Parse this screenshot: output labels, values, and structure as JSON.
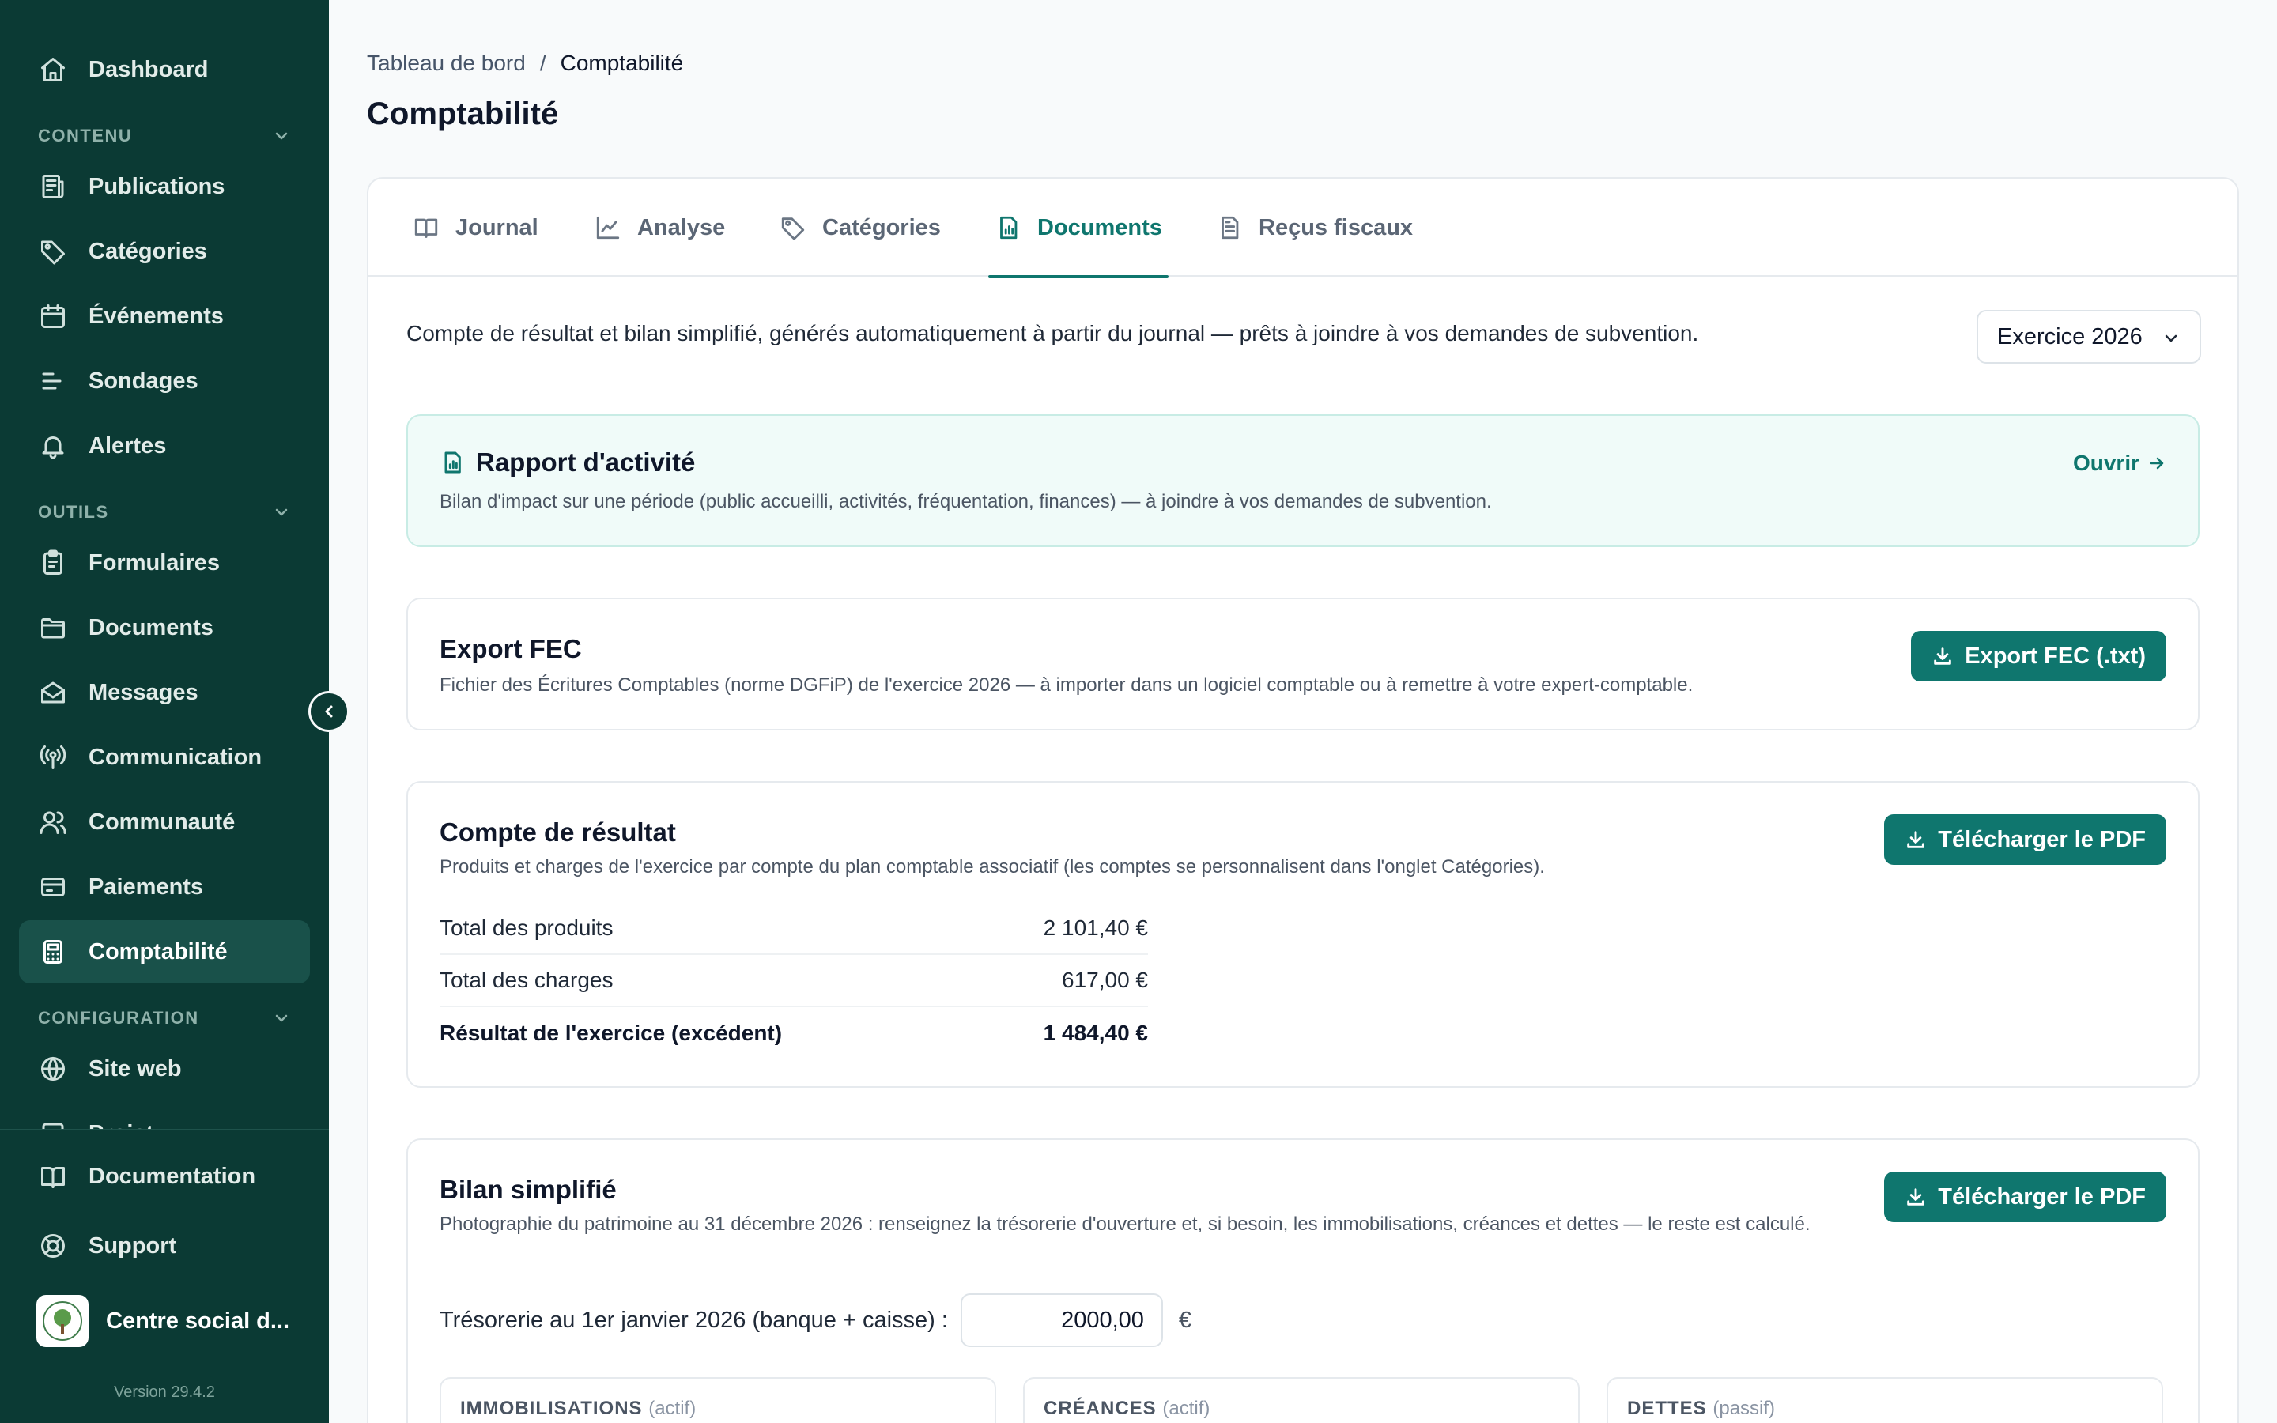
{
  "sidebar": {
    "items_top": [
      {
        "label": "Dashboard",
        "icon": "home-icon"
      }
    ],
    "sections": [
      {
        "label": "CONTENU",
        "items": [
          {
            "label": "Publications",
            "icon": "newspaper-icon"
          },
          {
            "label": "Catégories",
            "icon": "tag-icon"
          },
          {
            "label": "Événements",
            "icon": "calendar-icon"
          },
          {
            "label": "Sondages",
            "icon": "poll-icon"
          },
          {
            "label": "Alertes",
            "icon": "bell-icon"
          }
        ]
      },
      {
        "label": "OUTILS",
        "items": [
          {
            "label": "Formulaires",
            "icon": "clipboard-icon"
          },
          {
            "label": "Documents",
            "icon": "folder-icon"
          },
          {
            "label": "Messages",
            "icon": "mail-icon"
          },
          {
            "label": "Communication",
            "icon": "broadcast-icon"
          },
          {
            "label": "Communauté",
            "icon": "users-icon"
          },
          {
            "label": "Paiements",
            "icon": "card-icon"
          },
          {
            "label": "Comptabilité",
            "icon": "calculator-icon",
            "active": true
          }
        ]
      },
      {
        "label": "CONFIGURATION",
        "items": [
          {
            "label": "Site web",
            "icon": "globe-icon"
          },
          {
            "label": "Projet",
            "icon": "project-icon"
          }
        ]
      }
    ],
    "bottom": [
      {
        "label": "Documentation",
        "icon": "book-icon"
      },
      {
        "label": "Support",
        "icon": "lifebuoy-icon"
      }
    ],
    "org_name": "Centre social d...",
    "version": "Version 29.4.2"
  },
  "breadcrumb": {
    "root": "Tableau de bord",
    "separator": "/",
    "current": "Comptabilité"
  },
  "page_title": "Comptabilité",
  "tabs": [
    {
      "label": "Journal",
      "icon": "book-open-icon"
    },
    {
      "label": "Analyse",
      "icon": "chart-line-icon"
    },
    {
      "label": "Catégories",
      "icon": "tag-icon"
    },
    {
      "label": "Documents",
      "icon": "report-icon",
      "active": true
    },
    {
      "label": "Reçus fiscaux",
      "icon": "receipt-icon"
    }
  ],
  "intro": "Compte de résultat et bilan simplifié, générés automatiquement à partir du journal — prêts à joindre à vos demandes de subvention.",
  "year_select": "Exercice 2026",
  "rapport": {
    "title": "Rapport d'activité",
    "desc": "Bilan d'impact sur une période (public accueilli, activités, fréquentation, finances) — à joindre à vos demandes de subvention.",
    "link": "Ouvrir"
  },
  "fec": {
    "title": "Export FEC",
    "desc": "Fichier des Écritures Comptables (norme DGFiP) de l'exercice 2026 — à importer dans un logiciel comptable ou à remettre à votre expert-comptable.",
    "button": "Export FEC (.txt)"
  },
  "resultat": {
    "title": "Compte de résultat",
    "desc": "Produits et charges de l'exercice par compte du plan comptable associatif (les comptes se personnalisent dans l'onglet Catégories).",
    "button": "Télécharger le PDF",
    "rows": [
      {
        "label": "Total des produits",
        "value": "2 101,40 €"
      },
      {
        "label": "Total des charges",
        "value": "617,00 €"
      },
      {
        "label": "Résultat de l'exercice (excédent)",
        "value": "1 484,40 €"
      }
    ]
  },
  "bilan": {
    "title": "Bilan simplifié",
    "desc": "Photographie du patrimoine au 31 décembre 2026 : renseignez la trésorerie d'ouverture et, si besoin, les immobilisations, créances et dettes — le reste est calculé.",
    "button": "Télécharger le PDF",
    "treso_label": "Trésorerie au 1er janvier 2026 (banque + caisse) :",
    "treso_value": "2000,00",
    "treso_unit": "€",
    "cards": [
      {
        "label": "IMMOBILISATIONS",
        "sub": "(actif)"
      },
      {
        "label": "CRÉANCES",
        "sub": "(actif)"
      },
      {
        "label": "DETTES",
        "sub": "(passif)"
      }
    ]
  },
  "colors": {
    "sidebar_bg": "#0b3a34",
    "accent": "#0f766e",
    "active_item": "#19514a"
  }
}
